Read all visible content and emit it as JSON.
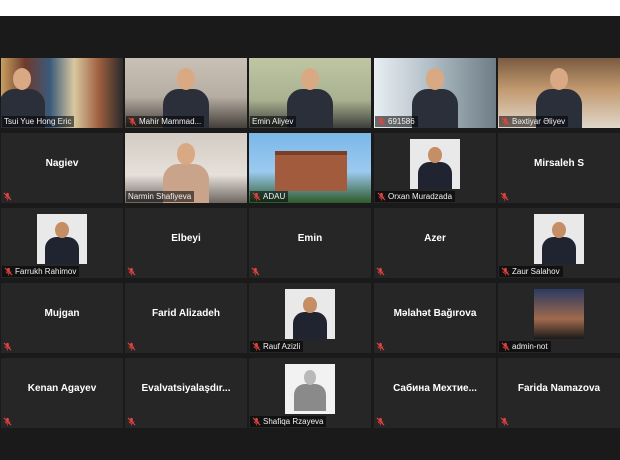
{
  "meeting": {
    "tiles": [
      {
        "name": "Tsui Yue Hong Eric",
        "style": "video",
        "bg": "grad-books",
        "muted": false
      },
      {
        "name": "Mahir Mammad...",
        "style": "video",
        "bg": "grad-office",
        "muted": true
      },
      {
        "name": "Emin Aliyev",
        "style": "video",
        "bg": "grad-green",
        "muted": false,
        "active": true
      },
      {
        "name": "691586",
        "style": "video",
        "bg": "grad-curtain",
        "muted": true
      },
      {
        "name": "Bəxtiyar Əliyev",
        "style": "video",
        "bg": "grad-shelf",
        "muted": true
      },
      {
        "name": "Nagiev",
        "style": "text",
        "muted": true
      },
      {
        "name": "Narmin Shafiyeva",
        "style": "video",
        "bg": "grad-room",
        "muted": false
      },
      {
        "name": "ADAU",
        "style": "video",
        "bg": "grad-sky",
        "muted": true
      },
      {
        "name": "Orxan Muradzada",
        "style": "thumb",
        "muted": true
      },
      {
        "name": "Mirsaleh S",
        "style": "text",
        "muted": true
      },
      {
        "name": "Farrukh Rahimov",
        "style": "thumb",
        "muted": true
      },
      {
        "name": "Elbeyi",
        "style": "text",
        "muted": true
      },
      {
        "name": "Emin",
        "style": "text",
        "muted": true
      },
      {
        "name": "Azer",
        "style": "text",
        "muted": true
      },
      {
        "name": "Zaur Salahov",
        "style": "thumb",
        "muted": true
      },
      {
        "name": "Mujgan",
        "style": "text",
        "muted": true
      },
      {
        "name": "Farid Alizadeh",
        "style": "text",
        "muted": true
      },
      {
        "name": "Rauf Azizli",
        "style": "thumb",
        "muted": true
      },
      {
        "name": "Məlahət Bağırova",
        "style": "text",
        "muted": true
      },
      {
        "name": "admin-not",
        "style": "thumb-night",
        "muted": true
      },
      {
        "name": "Kenan Agayev",
        "style": "text",
        "muted": true
      },
      {
        "name": "Evalvatsiyalaşdır...",
        "style": "text",
        "muted": true
      },
      {
        "name": "Shafiqa Rzayeva",
        "style": "thumb-sketch",
        "muted": true
      },
      {
        "name": "Sabina  Məxtie...",
        "display": "Сабина  Мехтие...",
        "style": "text",
        "muted": true
      },
      {
        "name": "Farida Namazova",
        "style": "text",
        "muted": true
      }
    ]
  },
  "colors": {
    "active_border": "#b9e04a",
    "mute_icon": "#e0443e",
    "tile_bg": "#262626",
    "window_bg": "#1a1a1a"
  },
  "icons": {
    "mute": "microphone-muted-icon"
  }
}
